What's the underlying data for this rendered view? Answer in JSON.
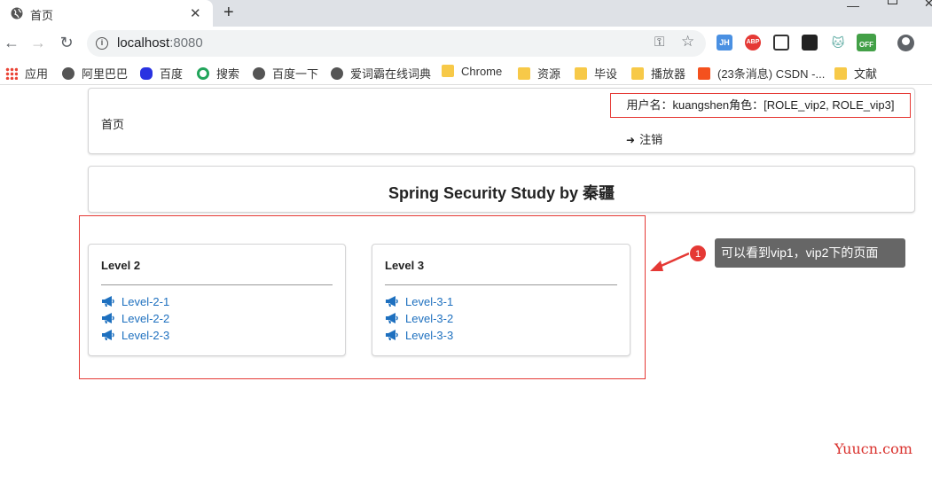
{
  "browser": {
    "tab_title": "首页",
    "url_host": "localhost",
    "url_port": ":8080",
    "extensions": [
      {
        "name": "JH",
        "color": "#4a90e2"
      },
      {
        "name": "ABP",
        "color": "#e53935"
      },
      {
        "name": "",
        "color": "#333333"
      },
      {
        "name": "",
        "color": "#222222"
      },
      {
        "name": "",
        "color": "#5aa9a0"
      },
      {
        "name": "OFF",
        "color": "#43a047"
      }
    ]
  },
  "bookmarks": [
    {
      "label": "应用",
      "icon": "apps-grid-icon"
    },
    {
      "label": "阿里巴巴",
      "icon": "globe-icon"
    },
    {
      "label": "百度",
      "icon": "baidu-paw-icon"
    },
    {
      "label": "搜索",
      "icon": "search-logo-icon"
    },
    {
      "label": "百度一下",
      "icon": "globe-icon"
    },
    {
      "label": "爱词霸在线词典",
      "icon": "globe-icon"
    },
    {
      "label": "Chrome",
      "icon": "folder-icon"
    },
    {
      "label": "资源",
      "icon": "folder-icon"
    },
    {
      "label": "毕设",
      "icon": "folder-icon"
    },
    {
      "label": "播放器",
      "icon": "folder-icon"
    },
    {
      "label": "(23条消息) CSDN -...",
      "icon": "csdn-icon"
    },
    {
      "label": "文献",
      "icon": "folder-icon"
    }
  ],
  "header": {
    "home_link": "首页",
    "user_info": "用户名：kuangshen角色：[ROLE_vip2, ROLE_vip3]",
    "logout": "注销"
  },
  "page": {
    "title": "Spring Security Study by 秦疆"
  },
  "levels": [
    {
      "header": "Level 2",
      "links": [
        "Level-2-1",
        "Level-2-2",
        "Level-2-3"
      ]
    },
    {
      "header": "Level 3",
      "links": [
        "Level-3-1",
        "Level-3-2",
        "Level-3-3"
      ]
    }
  ],
  "annotation": {
    "badge": "1",
    "text": "可以看到vip1，vip2下的页面"
  },
  "watermark": "Yuucn.com",
  "colors": {
    "link": "#1e70bf",
    "highlight": "#e53935",
    "annotation_bg": "#666666"
  }
}
